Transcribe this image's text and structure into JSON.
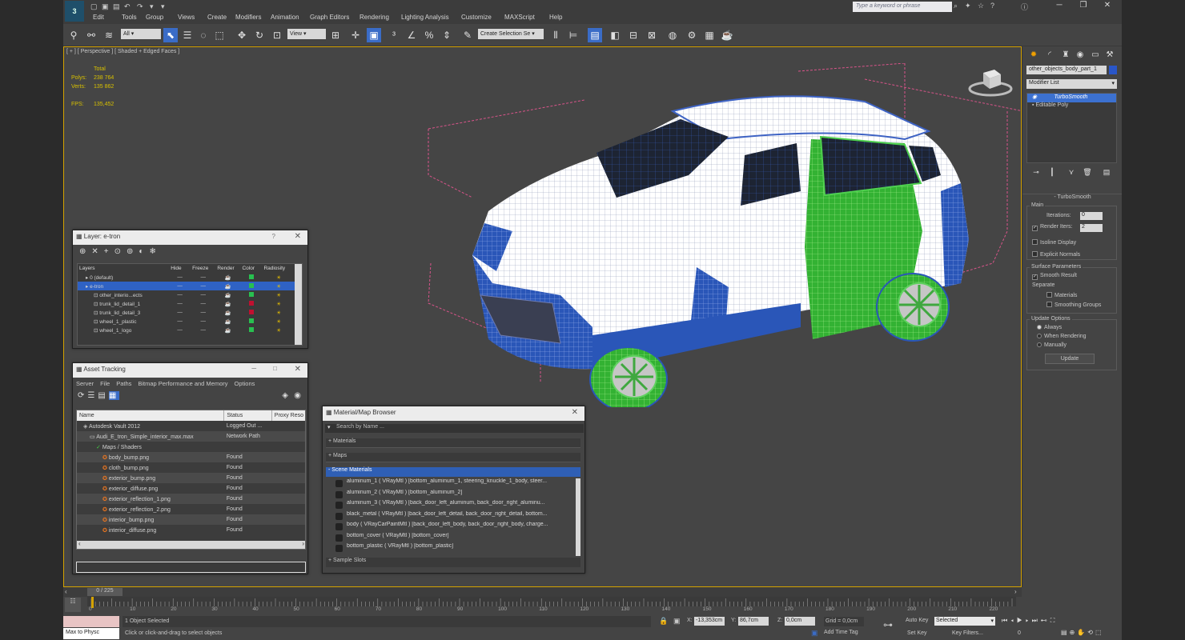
{
  "app": {
    "search_placeholder": "Type a keyword or phrase",
    "menus": [
      "Edit",
      "Tools",
      "Group",
      "Views",
      "Create",
      "Modifiers",
      "Animation",
      "Graph Editors",
      "Rendering",
      "Lighting Analysis",
      "Customize",
      "MAXScript",
      "Help"
    ],
    "win_min": "─",
    "win_restore": "❐",
    "win_close": "✕"
  },
  "toolbar": {
    "filter_dropdown": "All",
    "coord_dropdown": "View",
    "selection_set": "Create Selection Se"
  },
  "viewport": {
    "label": "[ + ] [ Perspective ] [ Shaded + Edged Faces ]",
    "stats_header": "Total",
    "polys_label": "Polys:",
    "polys_value": "238 764",
    "verts_label": "Verts:",
    "verts_value": "135 862",
    "fps_label": "FPS:",
    "fps_value": "135,452"
  },
  "command_panel": {
    "object_name": "other_objects_body_part_1",
    "modifier_list": "Modifier List",
    "stack": [
      {
        "label": "TurboSmooth",
        "selected": true
      },
      {
        "label": "Editable Poly",
        "selected": false
      }
    ],
    "rollout_title": "TurboSmooth",
    "main_group": "Main",
    "iterations_label": "Iterations:",
    "iterations_value": "0",
    "render_iters_label": "Render Iters:",
    "render_iters_value": "2",
    "isoline_display": "Isoline Display",
    "explicit_normals": "Explicit Normals",
    "surface_params": "Surface Parameters",
    "smooth_result": "Smooth Result",
    "separate": "Separate",
    "materials": "Materials",
    "smoothing_groups": "Smoothing Groups",
    "update_options": "Update Options",
    "always": "Always",
    "when_rendering": "When Rendering",
    "manually": "Manually",
    "update_button": "Update"
  },
  "layers": {
    "title": "Layer: e-tron",
    "close": "✕",
    "help": "?",
    "columns": [
      "Layers",
      "Hide",
      "Freeze",
      "Render",
      "Color",
      "Radiosity"
    ],
    "rows": [
      {
        "name": "0 (default)",
        "color": "#28c050",
        "indent": 1
      },
      {
        "name": "e-tron",
        "color": "#28c050",
        "indent": 1,
        "selected": true
      },
      {
        "name": "other_interio...ects",
        "color": "#28c050",
        "indent": 2
      },
      {
        "name": "trunk_lid_detail_1",
        "color": "#c01030",
        "indent": 2
      },
      {
        "name": "trunk_lid_detail_3",
        "color": "#c01030",
        "indent": 2
      },
      {
        "name": "wheel_1_plastic",
        "color": "#28c050",
        "indent": 2
      },
      {
        "name": "wheel_1_logo",
        "color": "#28c050",
        "indent": 2
      }
    ]
  },
  "asset_tracking": {
    "title": "Asset Tracking",
    "menus": [
      "Server",
      "File",
      "Paths",
      "Bitmap Performance and Memory",
      "Options"
    ],
    "columns": [
      "Name",
      "Status",
      "Proxy Reso"
    ],
    "rows": [
      {
        "name": "Autodesk Vault 2012",
        "status": "Logged Out ...",
        "indent": 1
      },
      {
        "name": "Audi_E_tron_Simple_interior_max.max",
        "status": "Network Path",
        "indent": 2
      },
      {
        "name": "Maps / Shaders",
        "status": "",
        "indent": 3
      },
      {
        "name": "body_bump.png",
        "status": "Found",
        "indent": 4
      },
      {
        "name": "cloth_bump.png",
        "status": "Found",
        "indent": 4
      },
      {
        "name": "exterior_bump.png",
        "status": "Found",
        "indent": 4
      },
      {
        "name": "exterior_diffuse.png",
        "status": "Found",
        "indent": 4
      },
      {
        "name": "exterior_reflection_1.png",
        "status": "Found",
        "indent": 4
      },
      {
        "name": "exterior_reflection_2.png",
        "status": "Found",
        "indent": 4
      },
      {
        "name": "interior_bump.png",
        "status": "Found",
        "indent": 4
      },
      {
        "name": "interior_diffuse.png",
        "status": "Found",
        "indent": 4
      }
    ]
  },
  "material_browser": {
    "title": "Material/Map Browser",
    "search": "Search by Name ...",
    "sections": [
      "+ Materials",
      "+ Maps",
      "- Scene Materials",
      "+ Sample Slots"
    ],
    "items": [
      "aluminum_1 ( VRayMtl ) [bottom_aluminum_1, steering_knuckle_1_body, steer...",
      "aluminum_2 ( VRayMtl ) [bottom_aluminum_2]",
      "aluminum_3 ( VRayMtl ) [back_door_left_aluminum, back_door_right_aluminu...",
      "black_metal ( VRayMtl ) [back_door_left_detail, back_door_right_detail, bottom...",
      "body ( VRayCarPaintMtl ) [back_door_left_body, back_door_right_body, charge...",
      "bottom_cover ( VRayMtl ) [bottom_cover]",
      "bottom_plastic ( VRayMtl ) [bottom_plastic]"
    ]
  },
  "timeline": {
    "frame": "0 / 225",
    "ticks": [
      "0",
      "10",
      "20",
      "30",
      "40",
      "50",
      "60",
      "70",
      "80",
      "90",
      "100",
      "110",
      "120",
      "130",
      "140",
      "150",
      "160",
      "170",
      "180",
      "190",
      "200",
      "210",
      "220"
    ]
  },
  "status": {
    "maxscript": "Max to Physc",
    "selection": "1 Object Selected",
    "prompt": "Click or click-and-drag to select objects",
    "x_label": "X:",
    "x_value": "-13,353cm",
    "y_label": "Y:",
    "y_value": "86,7cm",
    "z_label": "Z:",
    "z_value": "0,0cm",
    "grid": "Grid = 0,0cm",
    "add_time_tag": "Add Time Tag",
    "auto_key": "Auto Key",
    "selected_dropdown": "Selected",
    "set_key": "Set Key",
    "key_filters": "Key Filters...",
    "frame_field": "0"
  }
}
